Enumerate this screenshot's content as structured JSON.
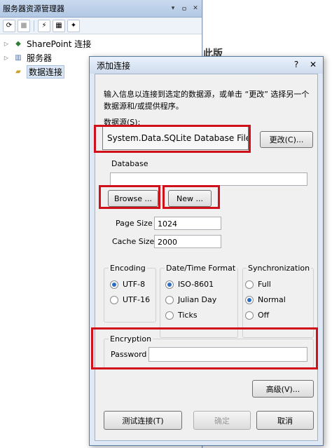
{
  "explorer": {
    "title": "服务器资源管理器",
    "title_controls": [
      "▾",
      "ㅁ",
      "✕"
    ],
    "tree": [
      {
        "label": "SharePoint 连接",
        "icon": "sharepoint-icon"
      },
      {
        "label": "服务器",
        "icon": "server-icon"
      },
      {
        "label": "数据连接",
        "icon": "data-connection-icon",
        "selected": true
      }
    ]
  },
  "background": {
    "partial_text": "此版"
  },
  "dialog": {
    "title": "添加连接",
    "help_btn": "?",
    "close_btn": "✕",
    "description": "输入信息以连接到选定的数据源，或单击 “更改” 选择另一个数据源和/或提供程序。",
    "datasource_label": "数据源(S):",
    "datasource_value": "System.Data.SQLite Database File (.N",
    "change_btn": "更改(C)...",
    "database_label": "Database",
    "database_value": "",
    "browse_btn": "Browse ...",
    "new_btn": "New ...",
    "page_size_label": "Page Size",
    "page_size_value": "1024",
    "cache_size_label": "Cache Size",
    "cache_size_value": "2000",
    "encoding": {
      "title": "Encoding",
      "options": [
        "UTF-8",
        "UTF-16"
      ],
      "selected": 0
    },
    "datetime": {
      "title": "Date/Time Format",
      "options": [
        "ISO-8601",
        "Julian Day",
        "Ticks"
      ],
      "selected": 0
    },
    "sync": {
      "title": "Synchronization",
      "options": [
        "Full",
        "Normal",
        "Off"
      ],
      "selected": 1
    },
    "encryption_title": "Encryption",
    "password_label": "Password",
    "password_value": "",
    "advanced_btn": "高级(V)...",
    "test_btn": "测试连接(T)",
    "ok_btn": "确定",
    "cancel_btn": "取消",
    "highlight_color": "#d0101a"
  }
}
